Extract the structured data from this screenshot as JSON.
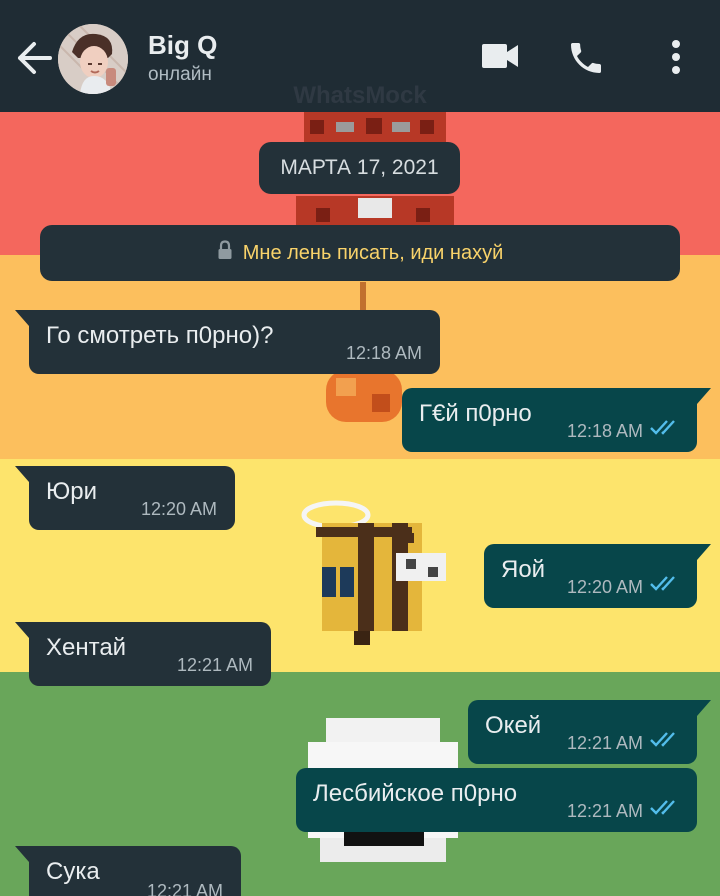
{
  "header": {
    "contact_name": "Big Q",
    "status": "онлайн",
    "icons": [
      "back-arrow-icon",
      "video-call-icon",
      "phone-icon",
      "more-options-icon"
    ]
  },
  "watermark": "WhatsMock",
  "date_chip": "МАРТА 17, 2021",
  "notice": {
    "icon": "lock-icon",
    "text": "Мне лень писать, иди нахуй"
  },
  "messages": [
    {
      "dir": "in",
      "text": "Го смотреть п0рно)?",
      "time": "12:18 AM"
    },
    {
      "dir": "out",
      "text": "Г€й п0рно",
      "time": "12:18 AM",
      "read": true
    },
    {
      "dir": "in",
      "text": "Юри",
      "time": "12:20 AM"
    },
    {
      "dir": "out",
      "text": "Яой",
      "time": "12:20 AM",
      "read": true
    },
    {
      "dir": "in",
      "text": "Хентай",
      "time": "12:21 AM"
    },
    {
      "dir": "out",
      "text": "Окей",
      "time": "12:21 AM",
      "read": true
    },
    {
      "dir": "out",
      "text": "Лесбийское п0рно",
      "time": "12:21 AM",
      "read": true
    },
    {
      "dir": "in",
      "text": "Сука",
      "time": "12:21 AM"
    }
  ],
  "colors": {
    "header": "#1f2c34",
    "incoming_bubble": "#233139",
    "outgoing_bubble": "#07464a",
    "read_ticks": "#53bdeb",
    "notice_text": "#f9d36a",
    "stripes": [
      "#f4675d",
      "#fcbf5d",
      "#fde46c",
      "#69a65a"
    ]
  }
}
